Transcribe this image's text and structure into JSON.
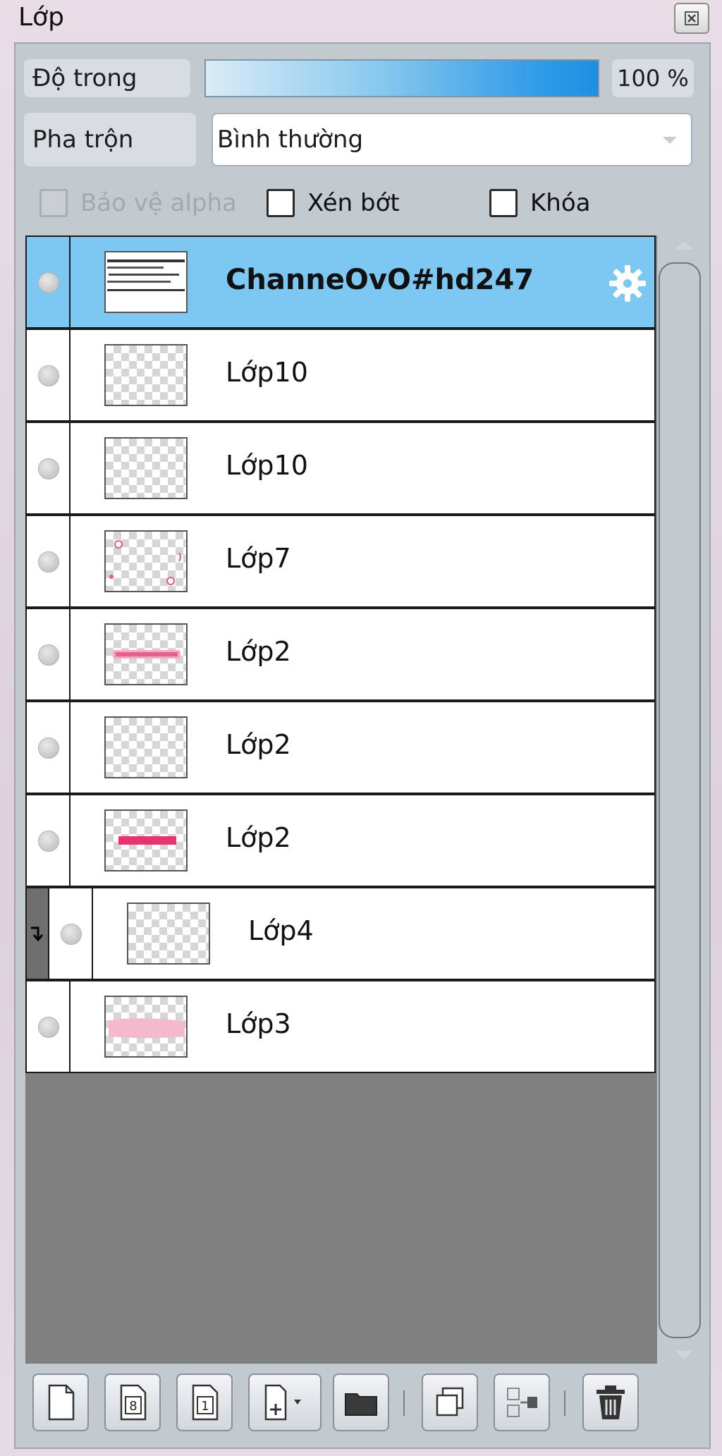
{
  "window": {
    "title": "Lớp"
  },
  "properties": {
    "opacity_label": "Độ trong",
    "opacity_value": "100 %",
    "opacity_level": 1.0,
    "blend_label": "Pha trộn",
    "blend_value": "Bình thường",
    "protect_alpha_label": "Bảo vệ alpha",
    "clip_label": "Xén bớt",
    "lock_label": "Khóa"
  },
  "layers": [
    {
      "name": "ChanneOvO#hd247",
      "selected": true
    },
    {
      "name": "Lớp10"
    },
    {
      "name": "Lớp10"
    },
    {
      "name": "Lớp7"
    },
    {
      "name": "Lớp2"
    },
    {
      "name": "Lớp2"
    },
    {
      "name": "Lớp2"
    },
    {
      "name": "Lớp4",
      "clipped": true
    },
    {
      "name": "Lớp3"
    }
  ],
  "toolbar": {
    "new_layer": "new-layer-icon",
    "new_8bit_layer": "8",
    "new_1bit_layer": "1",
    "add_layer_menu": "add-layer-dropdown-icon",
    "new_folder": "folder-icon",
    "duplicate": "duplicate-icon",
    "merge": "merge-down-icon",
    "delete": "trash-icon"
  },
  "colors": {
    "selected_row": "#7dc8f3",
    "opacity_bar": "#1e8fe3",
    "panel": "#c2c9cf"
  }
}
